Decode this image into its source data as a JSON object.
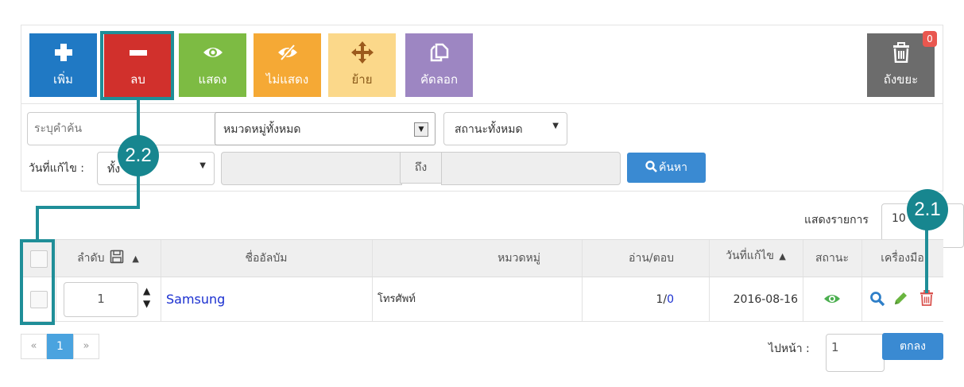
{
  "toolbar": {
    "add_label": "เพิ่ม",
    "delete_label": "ลบ",
    "show_label": "แสดง",
    "hide_label": "ไม่แสดง",
    "move_label": "ย้าย",
    "copy_label": "คัดลอก",
    "trash_label": "ถังขยะ",
    "trash_count": "0",
    "colors": {
      "add": "#2079c4",
      "delete": "#d1302c",
      "show": "#7dbb43",
      "hide": "#f5a935",
      "move": "#fbd88a",
      "copy": "#9d86c2",
      "trash": "#6c6c6c"
    }
  },
  "filters": {
    "search_placeholder": "ระบุคำค้น",
    "category_select": "หมวดหมู่ทั้งหมด",
    "status_select": "สถานะทั้งหมด",
    "date_label": "วันที่แก้ไข :",
    "date_select": "ทั้ง",
    "to_label": "ถึง",
    "search_button": "ค้นหา"
  },
  "display": {
    "label": "แสดงรายการ",
    "value": "10"
  },
  "table": {
    "headers": {
      "order": "ลำดับ",
      "album_name": "ชื่ออัลบัม",
      "category": "หมวดหมู่",
      "read_reply": "อ่าน/ตอบ",
      "modified": "วันที่แก้ไข",
      "status": "สถานะ",
      "tools": "เครื่องมือ"
    },
    "rows": [
      {
        "order": "1",
        "album_name": "Samsung",
        "category": "โทรศัพท์",
        "read": "1/",
        "reply": "0",
        "modified": "2016-08-16"
      }
    ]
  },
  "pagination": {
    "prev": "«",
    "current": "1",
    "next": "»",
    "goto_label": "ไปหน้า :",
    "goto_value": "1",
    "go_button": "ตกลง"
  },
  "annotations": {
    "callout_1": "2.1",
    "callout_2": "2.2"
  }
}
